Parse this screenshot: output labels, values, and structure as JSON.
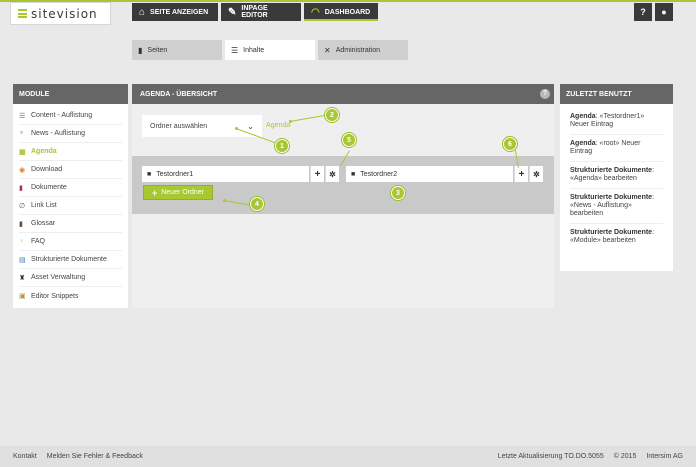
{
  "brand": {
    "logo_text": "sitevision"
  },
  "topnav": {
    "show_page": "SEITE ANZEIGEN",
    "inpage_editor": "INPAGE EDITOR",
    "dashboard": "DASHBOARD",
    "help_icon": "?",
    "user_icon": "user-icon"
  },
  "tabs": [
    {
      "label": "Seiten",
      "icon": "page-icon"
    },
    {
      "label": "Inhalte",
      "icon": "list-icon"
    },
    {
      "label": "Administration",
      "icon": "tools-icon"
    }
  ],
  "modules": {
    "title": "MODULE",
    "items": [
      {
        "label": "Content - Auflistung",
        "icon": "lines-icon",
        "color": "#3a7bbf"
      },
      {
        "label": "News - Auflistung",
        "icon": "antenna-icon",
        "color": "#3a7bbf"
      },
      {
        "label": "Agenda",
        "icon": "calendar-icon",
        "color": "#a8c832",
        "selected": true
      },
      {
        "label": "Download",
        "icon": "download-icon",
        "color": "#e07b20"
      },
      {
        "label": "Dokumente",
        "icon": "document-icon",
        "color": "#b03060"
      },
      {
        "label": "Link List",
        "icon": "link-icon",
        "color": "#555"
      },
      {
        "label": "Glossar",
        "icon": "book-icon",
        "color": "#6b4a2a"
      },
      {
        "label": "FAQ",
        "icon": "bulb-icon",
        "color": "#e8c020"
      },
      {
        "label": "Strukturierte Dokumente",
        "icon": "structured-icon",
        "color": "#3a7bbf"
      },
      {
        "label": "Asset Verwaltung",
        "icon": "asset-icon",
        "color": "#333"
      },
      {
        "label": "Editor Snippets",
        "icon": "snippet-icon",
        "color": "#c08a30"
      }
    ]
  },
  "main": {
    "title": "AGENDA - ÜBERSICHT",
    "help": "?",
    "select_placeholder": "Ordner auswählen",
    "breadcrumb": "Agenda",
    "folders": [
      {
        "name": "Testordner1"
      },
      {
        "name": "Testordner2"
      }
    ],
    "new_folder": "Neuer Ordner",
    "markers": [
      "1",
      "2",
      "3",
      "4",
      "5",
      "6"
    ]
  },
  "recent": {
    "title": "ZULETZT BENUTZT",
    "items": [
      {
        "bold": "Agenda",
        "text": ": «Testordner1» Neuer Eintrag"
      },
      {
        "bold": "Agenda",
        "text": ": «root» Neuer Eintrag"
      },
      {
        "bold": "Strukturierte Dokumente",
        "text": ": «Agenda» bearbeiten"
      },
      {
        "bold": "Strukturierte Dokumente",
        "text": ": «News - Auflistung» bearbeiten"
      },
      {
        "bold": "Strukturierte Dokumente",
        "text": ": «Module» bearbeiten"
      }
    ]
  },
  "footer": {
    "contact": "Kontakt",
    "feedback": "Melden Sie Fehler & Feedback",
    "last_update": "Letzte Aktualisierung TO.DO.5055",
    "copyright": "© 2015",
    "company": "Intersim AG"
  },
  "colors": {
    "accent": "#a8c832",
    "dark": "#3a3a3a",
    "panel_head": "#666666"
  }
}
